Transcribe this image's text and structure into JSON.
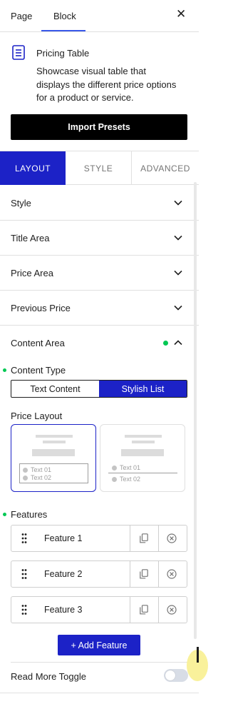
{
  "tabs": {
    "page": "Page",
    "block": "Block",
    "close": "✕"
  },
  "block": {
    "title": "Pricing Table",
    "description": "Showcase visual table that displays the different price options for a product or service.",
    "import_label": "Import Presets"
  },
  "panel_tabs": {
    "layout": "LAYOUT",
    "style": "STYLE",
    "advanced": "ADVANCED"
  },
  "panels": {
    "style": "Style",
    "title_area": "Title Area",
    "price_area": "Price Area",
    "previous_price": "Previous Price",
    "content_area": "Content Area"
  },
  "content_type": {
    "label": "Content Type",
    "options": [
      "Text Content",
      "Stylish List"
    ],
    "selected": "Stylish List"
  },
  "price_layout": {
    "label": "Price Layout",
    "option1_items": [
      "Text 01",
      "Text 02"
    ],
    "option2_items": [
      "Text 01",
      "Text 02"
    ]
  },
  "features": {
    "label": "Features",
    "items": [
      "Feature 1",
      "Feature 2",
      "Feature 3"
    ],
    "add_label": "+ Add Feature"
  },
  "read_more": {
    "label": "Read More Toggle",
    "enabled": false
  },
  "colors": {
    "accent": "#1c22c7",
    "green_dot": "#00c853",
    "tab_underline": "#3858e9"
  },
  "icons": {
    "block": "pricing-table-icon",
    "chevron": "chevron-down-icon",
    "chevron_up": "chevron-up-icon",
    "drag": "drag-handle-icon",
    "copy": "duplicate-icon",
    "remove": "remove-circle-icon"
  }
}
